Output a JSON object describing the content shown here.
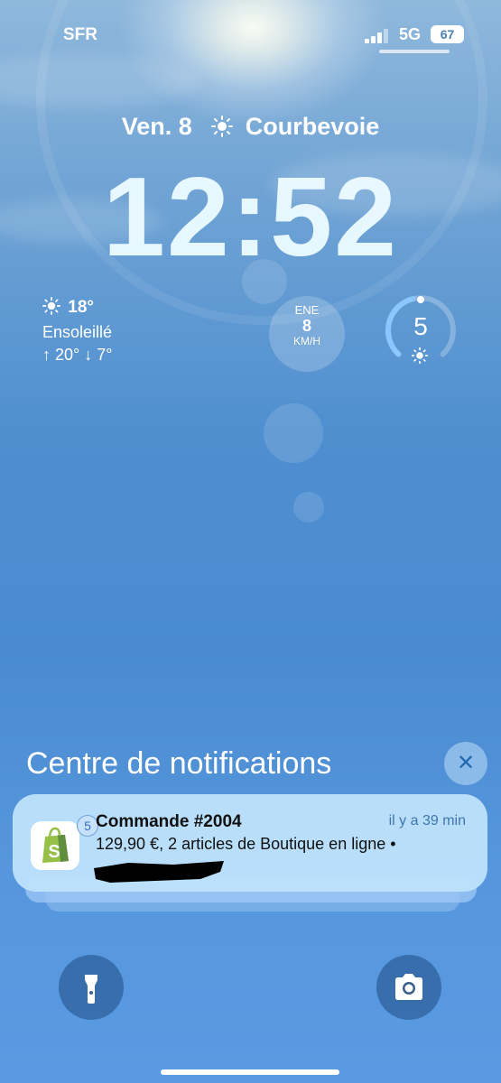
{
  "status_bar": {
    "carrier": "SFR",
    "network": "5G",
    "battery": "67"
  },
  "lock_screen": {
    "date": "Ven. 8",
    "weather_icon": "sun-icon",
    "location": "Courbevoie",
    "time": "12:52"
  },
  "widgets": {
    "weather": {
      "temperature": "18°",
      "condition": "Ensoleillé",
      "high_low": "↑ 20° ↓ 7°"
    },
    "wind": {
      "direction": "ENE",
      "speed": "8",
      "unit": "KM/H"
    },
    "uv": {
      "index": "5",
      "level_fraction": 0.45
    }
  },
  "notification_center": {
    "title": "Centre de notifications",
    "close_icon": "close-icon",
    "notification": {
      "app": "Shopify",
      "badge": "5",
      "title": "Commande #2004",
      "time": "il y a 39 min",
      "body": "129,90 €, 2 articles de Boutique en ligne •"
    }
  },
  "bottom_controls": {
    "left": "flashlight-icon",
    "right": "camera-icon"
  },
  "colors": {
    "card_bg": "#bee1fc",
    "accent": "#2f73bb",
    "shopify_green": "#95bf47"
  }
}
